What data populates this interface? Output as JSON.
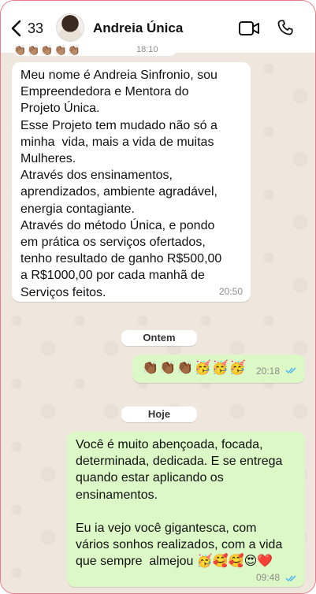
{
  "header": {
    "back_count": "33",
    "contact_name": "Andreia Única"
  },
  "previous_message": {
    "emoji": "👏🏽👏🏽👏🏽👏🏽👏🏽",
    "time": "18:10"
  },
  "messages": [
    {
      "direction": "incoming",
      "text": "Meu nome é Andreia Sinfronio, sou\nEmpreendedora e Mentora do\nProjeto Única.\nEsse Projeto tem mudado não só a\nminha  vida, mais a vida de muitas\nMulheres.\nAtravés dos ensinamentos,\naprendizados, ambiente agradável,\nenergia contagiante.\nAtravés do método Única, e pondo\nem prática os serviços ofertados,\ntenho resultado de ganho R$500,00\na R$1000,00 por cada manhã de\nServiços feitos.",
      "time": "20:50"
    },
    {
      "direction": "outgoing",
      "text": "👏🏾👏🏾👏🏾🥳🥳🥳",
      "time": "20:18",
      "status": "read"
    },
    {
      "direction": "outgoing",
      "text": "Você é muito abençoada, focada,\ndeterminada, dedicada. E se entrega\nquando estar aplicando os\nensinamentos.\n\nEu ia vejo você gigantesca, com\nvários sonhos realizados, com a vida\nque sempre  almejou 🥳🥰🥰😍❤️",
      "time": "09:48",
      "status": "read"
    }
  ],
  "day_separators": [
    "Ontem",
    "Hoje"
  ],
  "colors": {
    "incoming_bubble": "#ffffff",
    "outgoing_bubble": "#dcf8c6",
    "read_ticks": "#4fb6ec",
    "wallpaper": "#efe7de",
    "frame_border": "#e47b8c"
  }
}
